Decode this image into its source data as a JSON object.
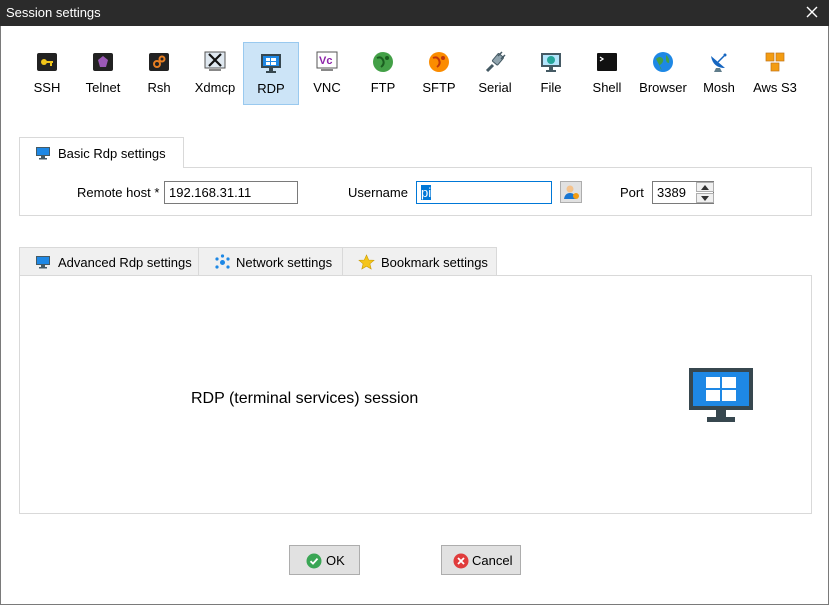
{
  "window": {
    "title": "Session settings",
    "close_icon": "close-icon"
  },
  "session_types": [
    {
      "label": "SSH",
      "icon": "key-icon",
      "color": "#f0c419"
    },
    {
      "label": "Telnet",
      "icon": "telnet-gem-icon",
      "color": "#8e44ad"
    },
    {
      "label": "Rsh",
      "icon": "rsh-icon",
      "color": "#e67e22"
    },
    {
      "label": "Xdmcp",
      "icon": "x-window-icon",
      "color": "#1f1f1f"
    },
    {
      "label": "RDP",
      "icon": "rdp-monitor-icon",
      "color": "#1e88e5",
      "selected": true
    },
    {
      "label": "VNC",
      "icon": "vnc-icon",
      "color": "#8e24aa"
    },
    {
      "label": "FTP",
      "icon": "ftp-globe-icon",
      "color": "#43a047"
    },
    {
      "label": "SFTP",
      "icon": "sftp-globe-icon",
      "color": "#fb8c00"
    },
    {
      "label": "Serial",
      "icon": "serial-plug-icon",
      "color": "#607d8b"
    },
    {
      "label": "File",
      "icon": "file-monitor-icon",
      "color": "#26a69a"
    },
    {
      "label": "Shell",
      "icon": "shell-terminal-icon",
      "color": "#000000"
    },
    {
      "label": "Browser",
      "icon": "browser-globe-icon",
      "color": "#1e88e5"
    },
    {
      "label": "Mosh",
      "icon": "mosh-dish-icon",
      "color": "#1565c0"
    },
    {
      "label": "Aws S3",
      "icon": "aws-s3-icon",
      "color": "#f39c12"
    }
  ],
  "basic": {
    "tab_label": "Basic Rdp settings",
    "remote_host_label": "Remote host *",
    "remote_host_value": "192.168.31.11",
    "username_label": "Username",
    "username_value": "pi",
    "port_label": "Port",
    "port_value": "3389"
  },
  "advanced_tabs": [
    {
      "label": "Advanced Rdp settings",
      "icon": "monitor-icon"
    },
    {
      "label": "Network settings",
      "icon": "network-icon"
    },
    {
      "label": "Bookmark settings",
      "icon": "star-icon"
    }
  ],
  "panel": {
    "caption": "RDP (terminal services) session"
  },
  "buttons": {
    "ok_label": "OK",
    "cancel_label": "Cancel"
  },
  "colors": {
    "titlebar": "#2b2b2b",
    "selected_bg": "#cce4f7",
    "accent": "#0078d7",
    "ok_green": "#3aa655",
    "cancel_red": "#e03c3c"
  }
}
